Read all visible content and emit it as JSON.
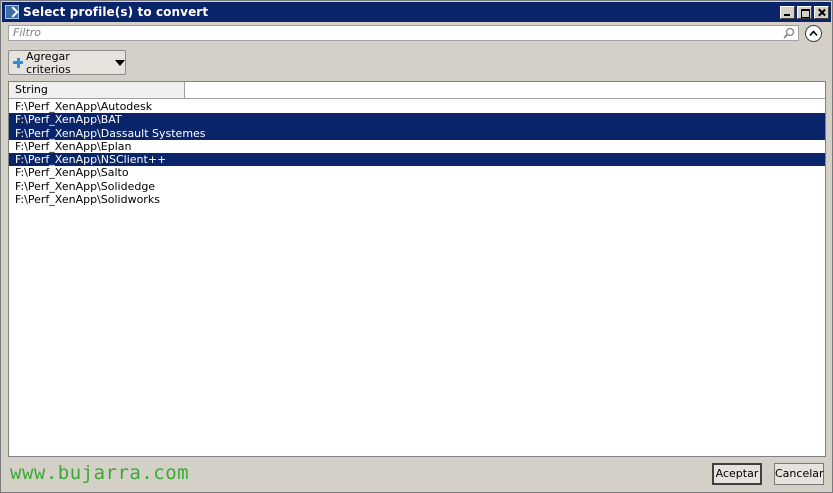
{
  "window": {
    "title": "Select profile(s) to convert",
    "icon": "powershell-icon"
  },
  "filter": {
    "placeholder": "Filtro",
    "value": ""
  },
  "toolbar": {
    "add_criteria_label": "Agregar criterios"
  },
  "grid": {
    "columns": [
      "String"
    ],
    "rows": [
      {
        "value": "F:\\Perf_XenApp\\Autodesk",
        "selected": false
      },
      {
        "value": "F:\\Perf_XenApp\\BAT",
        "selected": true
      },
      {
        "value": "F:\\Perf_XenApp\\Dassault Systemes",
        "selected": true
      },
      {
        "value": "F:\\Perf_XenApp\\Eplan",
        "selected": false
      },
      {
        "value": "F:\\Perf_XenApp\\NSClient++",
        "selected": true
      },
      {
        "value": "F:\\Perf_XenApp\\Salto",
        "selected": false
      },
      {
        "value": "F:\\Perf_XenApp\\Solidedge",
        "selected": false
      },
      {
        "value": "F:\\Perf_XenApp\\Solidworks",
        "selected": false
      }
    ]
  },
  "footer": {
    "watermark": "www.bujarra.com",
    "ok_label": "Aceptar",
    "cancel_label": "Cancelar"
  },
  "colors": {
    "titlebar": "#0a246a",
    "selection": "#0a246a",
    "watermark": "#3aaa35"
  }
}
